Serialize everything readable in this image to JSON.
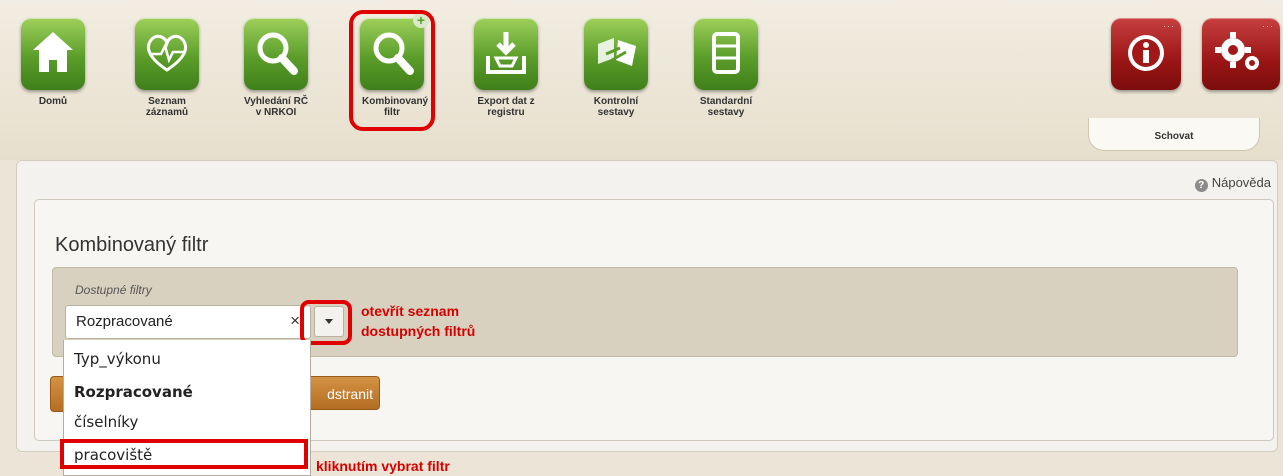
{
  "toolbar": {
    "items": [
      {
        "label": "Domů",
        "icon": "home-icon"
      },
      {
        "label": "Seznam záznamů",
        "icon": "heart-list-icon"
      },
      {
        "label": "Vyhledání RČ v NRKOI",
        "icon": "search-icon"
      },
      {
        "label": "Kombinovaný filtr",
        "icon": "search-plus-icon"
      },
      {
        "label": "Export dat z registru",
        "icon": "export-icon"
      },
      {
        "label": "Kontrolní sestavy",
        "icon": "control-reports-icon"
      },
      {
        "label": "Standardní sestavy",
        "icon": "standard-reports-icon"
      }
    ],
    "info_icon": "info-icon",
    "settings_icon": "gears-icon",
    "hide_label": "Schovat"
  },
  "help": {
    "label": "Nápověda"
  },
  "main": {
    "title": "Kombinovaný filtr",
    "filter_label": "Dostupné filtry",
    "selected_value": "Rozpracované",
    "clear_symbol": "×",
    "remove_button_fragment": "dstranit"
  },
  "dropdown": {
    "options": [
      "Typ_výkonu",
      "Rozpracované",
      "číselníky",
      "pracoviště"
    ],
    "bold_option": "Rozpracované"
  },
  "annotations": {
    "open_list_line1": "otevřít seznam",
    "open_list_line2": "dostupných filtrů",
    "click_select": "kliknutím vybrat filtr"
  },
  "colors": {
    "annotation_red": "#e00000",
    "icon_green": "#5b9d2a",
    "icon_red": "#9a1515",
    "button_orange": "#c47f33"
  }
}
